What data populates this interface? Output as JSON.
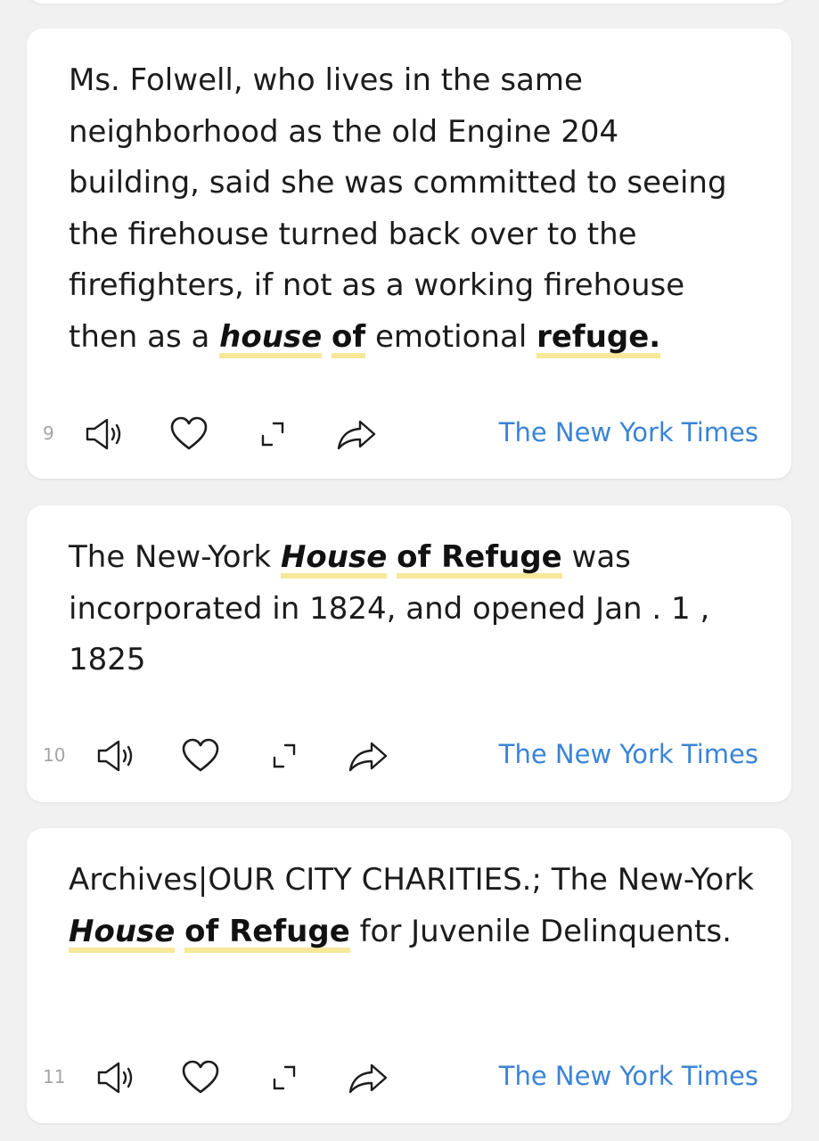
{
  "cards": [
    {
      "index": "9",
      "parts": [
        {
          "text": "Ms. Folwell, who lives in the same neighborhood as the old Engine 204 building, said she was committed to seeing the firehouse turned back over to the firefighters, if not as a working firehouse then as a "
        },
        {
          "text": "house",
          "style": "hl it"
        },
        {
          "text": " "
        },
        {
          "text": "of",
          "style": "hl bd"
        },
        {
          "text": " emotional "
        },
        {
          "text": "refuge.",
          "style": "hl bd"
        }
      ],
      "source": "The New York Times"
    },
    {
      "index": "10",
      "parts": [
        {
          "text": "The New-York "
        },
        {
          "text": "House",
          "style": "hl it"
        },
        {
          "text": " "
        },
        {
          "text": "of Refuge",
          "style": "hl bd"
        },
        {
          "text": " was incorporated in 1824, and opened Jan . 1 , 1825"
        }
      ],
      "source": "The New York Times"
    },
    {
      "index": "11",
      "parts": [
        {
          "text": "Archives|OUR CITY CHARITIES.; The New-York "
        },
        {
          "text": "House",
          "style": "hl it"
        },
        {
          "text": " "
        },
        {
          "text": "of Refuge",
          "style": "hl bd"
        },
        {
          "text": " for Juvenile Delinquents."
        }
      ],
      "source": "The New York Times"
    }
  ],
  "icons": {
    "speaker": "speaker-icon",
    "favorite": "heart-icon",
    "expand": "expand-icon",
    "share": "share-icon"
  },
  "colors": {
    "background": "#f1f1f1",
    "card": "#ffffff",
    "source_link": "#3b84d6",
    "highlight": "#f7e89a",
    "index_text": "#a4a4a4"
  }
}
